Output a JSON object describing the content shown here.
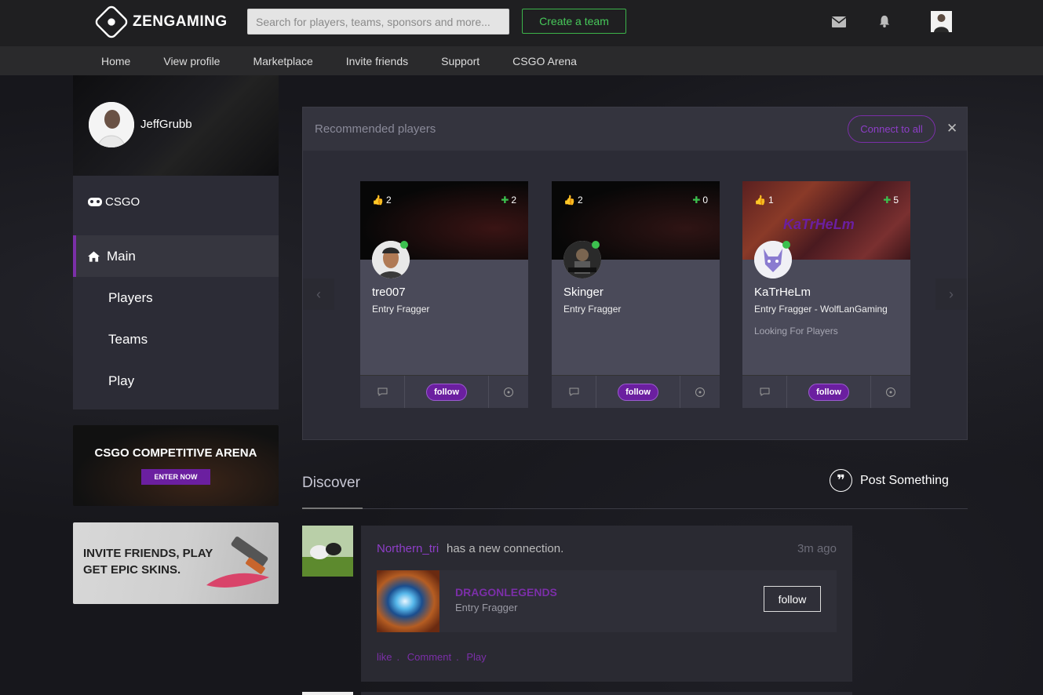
{
  "brand": {
    "name": "ZENGAMING"
  },
  "search": {
    "placeholder": "Search for players, teams, sponsors and more..."
  },
  "header": {
    "create_team_label": "Create a team",
    "icons": [
      "mail-icon",
      "bell-icon"
    ]
  },
  "nav": {
    "items": [
      "Home",
      "View profile",
      "Marketplace",
      "Invite friends",
      "Support",
      "CSGO Arena"
    ]
  },
  "profile": {
    "name": "JeffGrubb",
    "game": "CSGO"
  },
  "sidebar": {
    "menu": [
      "Main",
      "Players",
      "Teams",
      "Play"
    ]
  },
  "banners": {
    "arena_title": "CSGO COMPETITIVE ARENA",
    "arena_button": "ENTER NOW",
    "invite_line1": "INVITE FRIENDS, PLAY",
    "invite_line2": "GET EPIC SKINS."
  },
  "recommended": {
    "title": "Recommended players",
    "connect_all": "Connect to all",
    "close": "✕",
    "prev": "‹",
    "next": "›",
    "players": [
      {
        "likes": "2",
        "plus": "2",
        "name": "tre007",
        "role": "Entry Fragger",
        "status": "",
        "follow": "follow"
      },
      {
        "likes": "2",
        "plus": "0",
        "name": "Skinger",
        "role": "Entry Fragger",
        "status": "",
        "follow": "follow"
      },
      {
        "likes": "1",
        "plus": "5",
        "name": "KaTrHeLm",
        "role": "Entry Fragger - WolfLanGaming",
        "status": "Looking For Players",
        "follow": "follow",
        "cover_text": "KaTrHeLm"
      }
    ]
  },
  "discover": {
    "title": "Discover",
    "post_label": "Post Something",
    "feed": {
      "user": "Northern_tri",
      "text": "has a new connection.",
      "time": "3m ago",
      "connection_name": "DRAGONLEGENDS",
      "connection_role": "Entry Fragger",
      "follow_label": "follow",
      "actions": [
        "like",
        "Comment",
        "Play"
      ]
    }
  },
  "colors": {
    "accent": "#7b2fa8",
    "green": "#3cc04e",
    "panel": "#2c2c36"
  }
}
